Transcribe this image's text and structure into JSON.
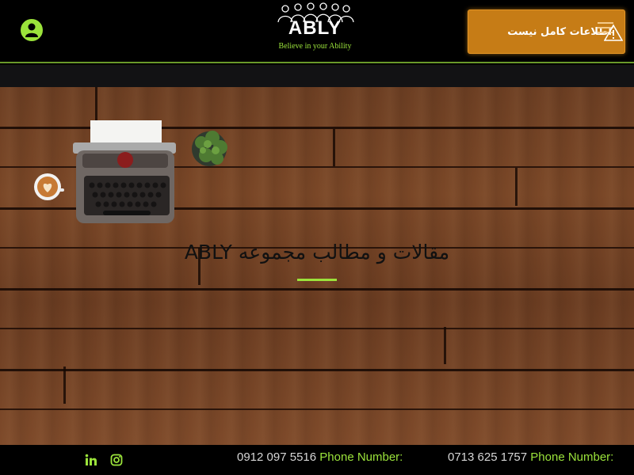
{
  "header": {
    "logo_name": "ABLY",
    "logo_tagline": "Believe in your Ability",
    "alert_text": "اطلاعات کامل نیست",
    "user_icon": "user-icon",
    "alert_icon": "warning-icon",
    "menu_icon": "hamburger-menu-icon"
  },
  "hero": {
    "title": "مقالات و مطالب مجموعه ABLY"
  },
  "footer": {
    "phones": [
      {
        "label": "Phone Number:",
        "number": "0713 625 1757"
      },
      {
        "label": "Phone Number:",
        "number": "0912 097 5516"
      }
    ],
    "social": [
      "linkedin-icon",
      "instagram-icon"
    ]
  },
  "colors": {
    "accent": "#9be33b",
    "alert": "#c67c16",
    "background": "#000000"
  }
}
